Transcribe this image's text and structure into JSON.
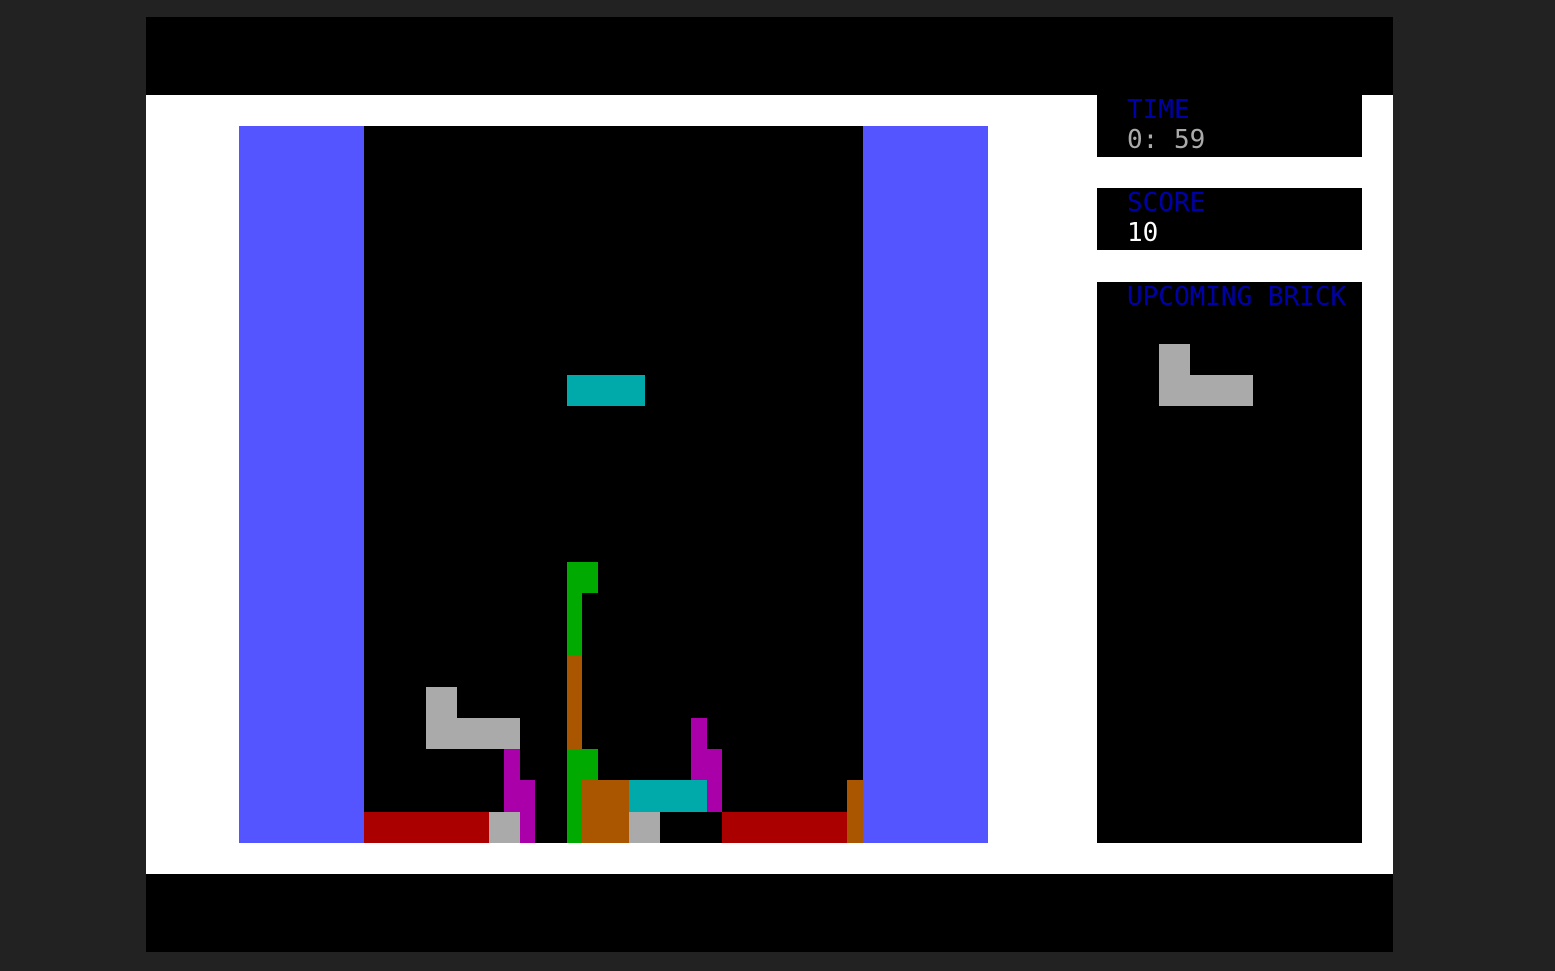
{
  "game": {
    "title": "",
    "time": {
      "label": "TIME",
      "value": "0: 59"
    },
    "score": {
      "label": "SCORE",
      "value": "10"
    },
    "upcoming": {
      "label": "UPCOMING BRICK",
      "shape": "L-piece",
      "color": "#aaaaaa"
    }
  },
  "colors": {
    "background": "#222222",
    "frame": "#000000",
    "field": "#ffffff",
    "wall": "#5555ff",
    "well": "#000000",
    "label": "#0000aa",
    "time_value": "#aaaaaa",
    "score_value": "#ffffff",
    "brick_red": "#aa0000",
    "brick_gray": "#aaaaaa",
    "brick_magenta": "#aa00aa",
    "brick_green": "#00aa00",
    "brick_orange": "#aa5500",
    "brick_cyan": "#00aaaa"
  },
  "board": {
    "columns": 16,
    "rows": 23,
    "falling_brick": {
      "shape": "I-piece",
      "color": "#00aaaa"
    }
  }
}
